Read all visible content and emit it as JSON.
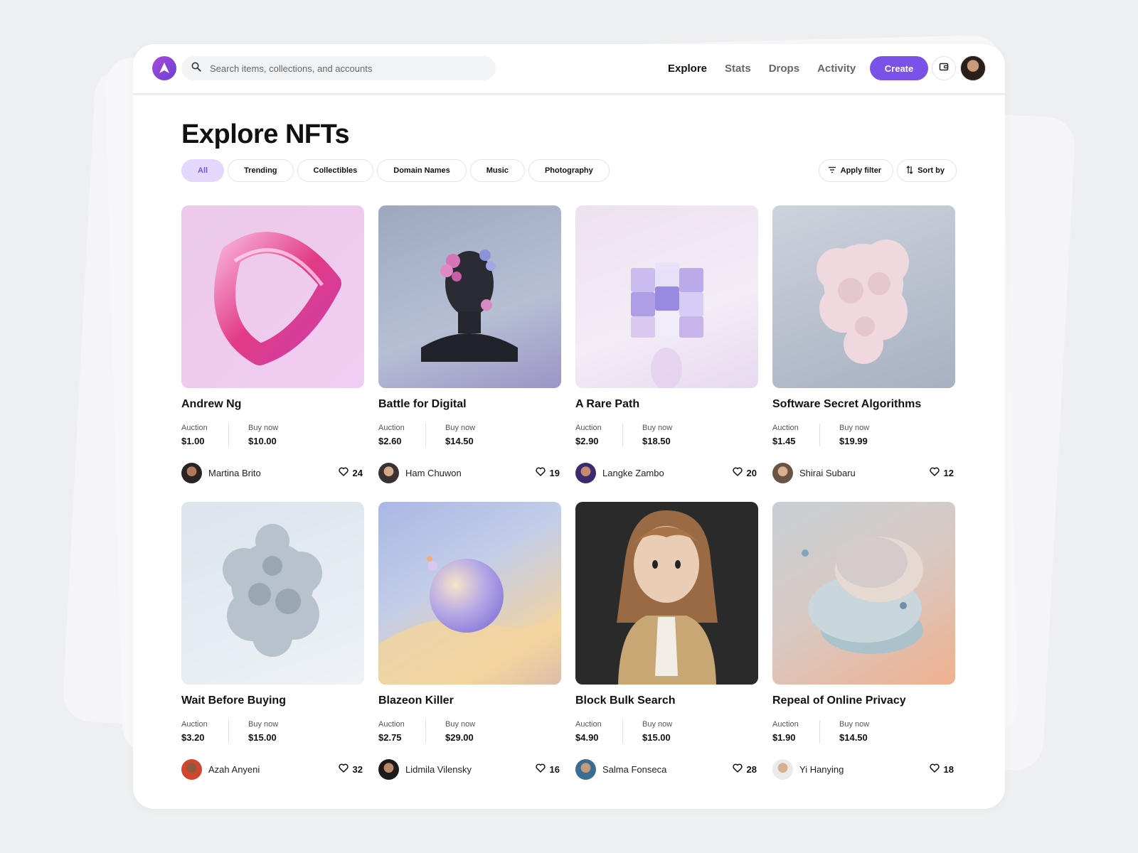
{
  "header": {
    "search_placeholder": "Search items, collections, and accounts",
    "nav": [
      "Explore",
      "Stats",
      "Drops",
      "Activity"
    ],
    "active_nav": "Explore",
    "create_label": "Create"
  },
  "page": {
    "title": "Explore NFTs"
  },
  "filters": {
    "chips": [
      "All",
      "Trending",
      "Collectibles",
      "Domain Names",
      "Music",
      "Photography"
    ],
    "active": "All",
    "apply_filter": "Apply filter",
    "sort_by": "Sort by"
  },
  "labels": {
    "auction": "Auction",
    "buy_now": "Buy now"
  },
  "cards": [
    {
      "title": "Andrew Ng",
      "auction": "$1.00",
      "buy_now": "$10.00",
      "owner": "Martina Brito",
      "likes": "24"
    },
    {
      "title": "Battle for Digital",
      "auction": "$2.60",
      "buy_now": "$14.50",
      "owner": "Ham Chuwon",
      "likes": "19"
    },
    {
      "title": "A Rare Path",
      "auction": "$2.90",
      "buy_now": "$18.50",
      "owner": "Langke Zambo",
      "likes": "20"
    },
    {
      "title": "Software Secret Algorithms",
      "auction": "$1.45",
      "buy_now": "$19.99",
      "owner": "Shirai Subaru",
      "likes": "12"
    },
    {
      "title": "Wait Before Buying",
      "auction": "$3.20",
      "buy_now": "$15.00",
      "owner": "Azah Anyeni",
      "likes": "32"
    },
    {
      "title": "Blazeon Killer",
      "auction": "$2.75",
      "buy_now": "$29.00",
      "owner": "Lidmila Vilensky",
      "likes": "16"
    },
    {
      "title": "Block Bulk Search",
      "auction": "$4.90",
      "buy_now": "$15.00",
      "owner": "Salma Fonseca",
      "likes": "28"
    },
    {
      "title": "Repeal of Online Privacy",
      "auction": "$1.90",
      "buy_now": "$14.50",
      "owner": "Yi Hanying",
      "likes": "18"
    }
  ],
  "colors": {
    "accent": "#7b52e8",
    "chip_active_bg": "#e3d8fb",
    "chip_active_text": "#7a55e0"
  },
  "icons": [
    "logo-icon",
    "search-icon",
    "wallet-icon",
    "filter-icon",
    "sort-icon",
    "heart-icon"
  ]
}
